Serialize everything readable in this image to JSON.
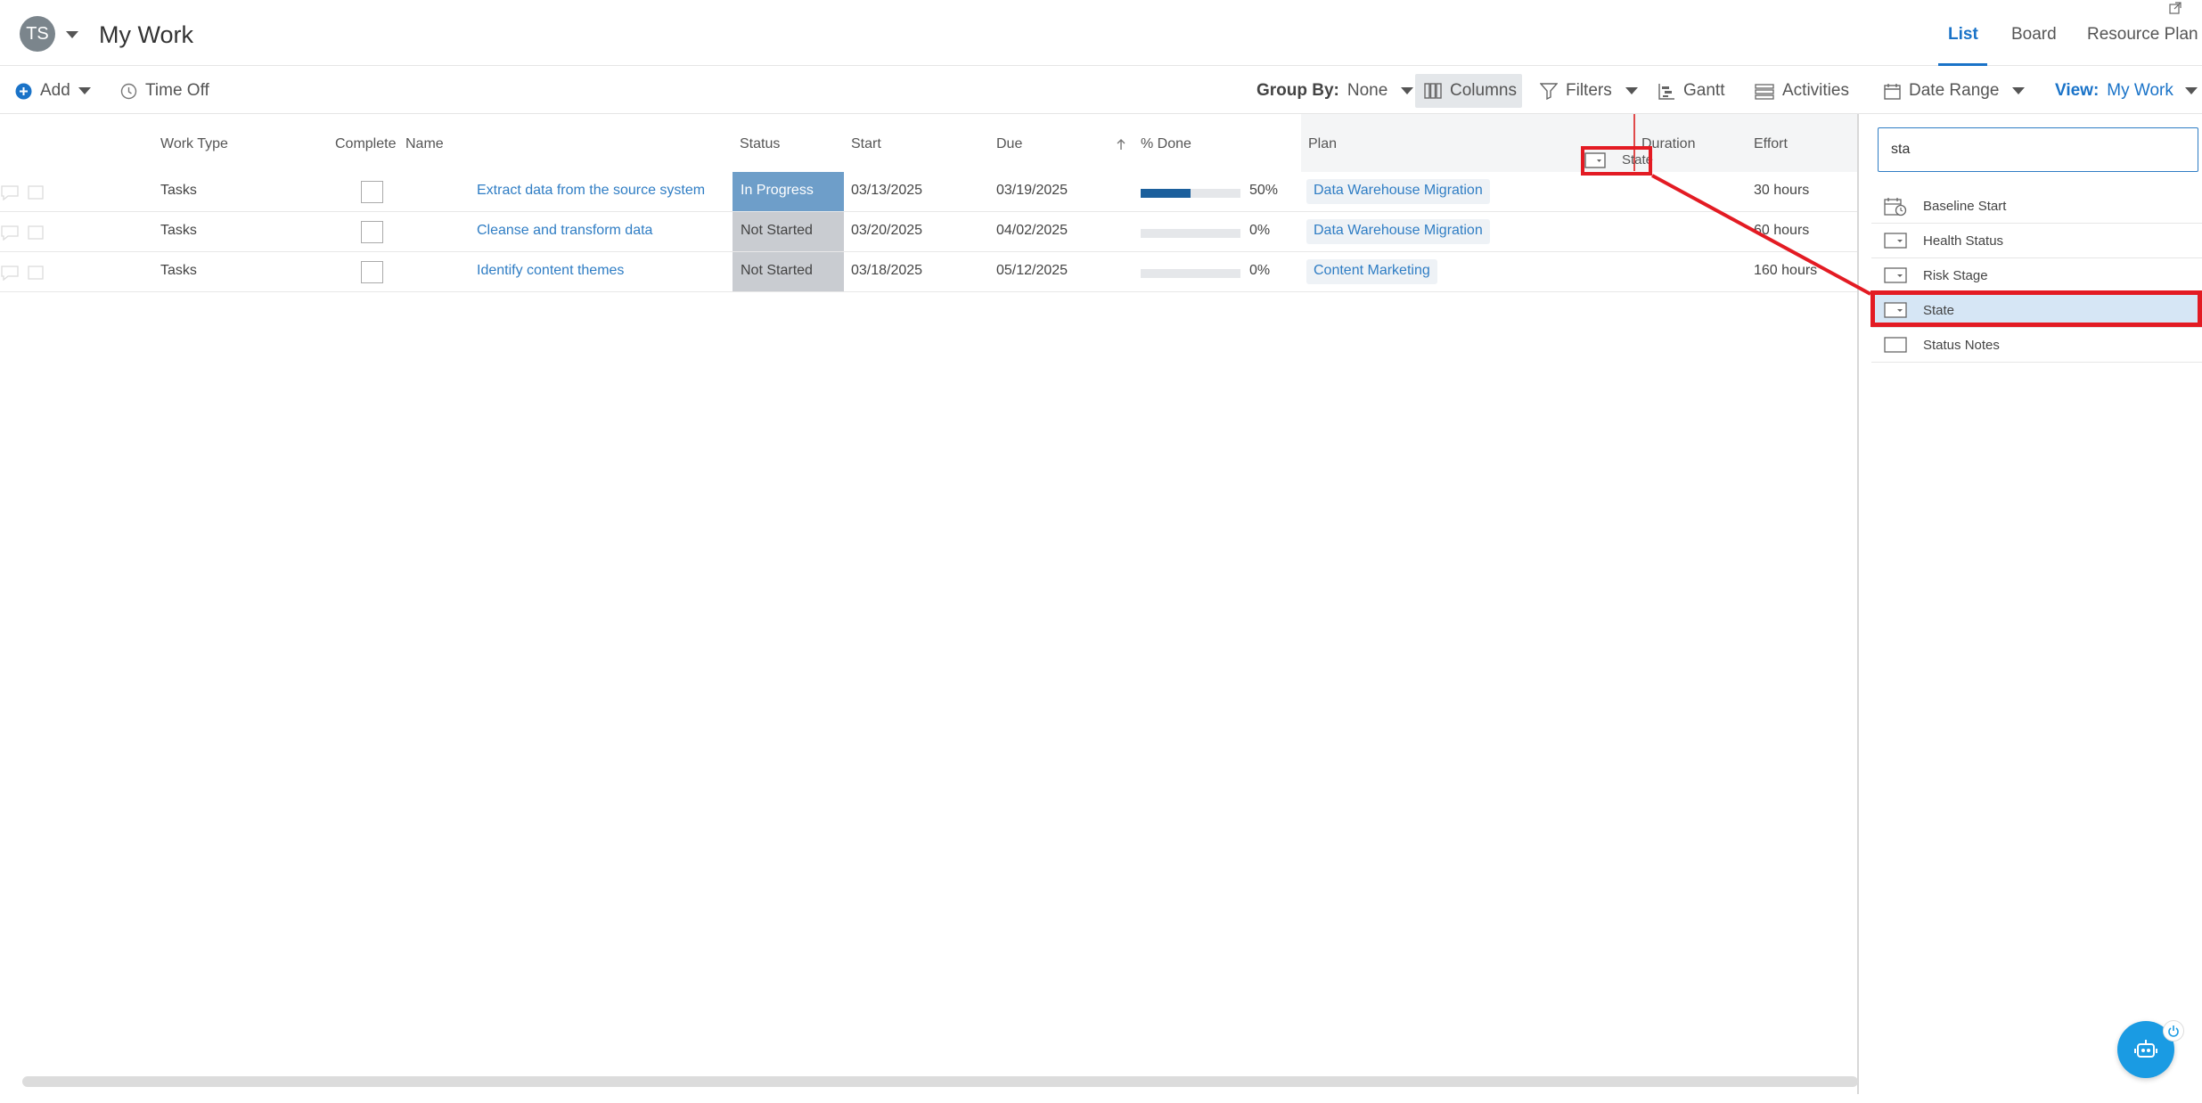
{
  "header": {
    "avatar_initials": "TS",
    "page_title": "My Work",
    "view_tabs": [
      {
        "label": "List",
        "active": true
      },
      {
        "label": "Board",
        "active": false
      },
      {
        "label": "Resource Plan",
        "active": false
      }
    ]
  },
  "toolbar": {
    "add_label": "Add",
    "time_off_label": "Time Off",
    "group_by_label": "Group By:",
    "group_by_value": "None",
    "columns_label": "Columns",
    "filters_label": "Filters",
    "gantt_label": "Gantt",
    "activities_label": "Activities",
    "date_range_label": "Date Range",
    "view_label": "View:",
    "view_value": "My Work"
  },
  "table": {
    "headers": {
      "work_type": "Work Type",
      "complete": "Complete",
      "name": "Name",
      "status": "Status",
      "start": "Start",
      "due": "Due",
      "pct_done": "% Done",
      "plan": "Plan",
      "duration": "Duration",
      "effort": "Effort"
    },
    "dragged_column_label": "State",
    "rows": [
      {
        "work_type": "Tasks",
        "name": "Extract data from the source system",
        "status": "In Progress",
        "start": "03/13/2025",
        "due": "03/19/2025",
        "pct_done": 50,
        "pct_label": "50%",
        "plan": "Data Warehouse Migration",
        "effort": "30 hours"
      },
      {
        "work_type": "Tasks",
        "name": "Cleanse and transform data",
        "status": "Not Started",
        "start": "03/20/2025",
        "due": "04/02/2025",
        "pct_done": 0,
        "pct_label": "0%",
        "plan": "Data Warehouse Migration",
        "effort": "60 hours"
      },
      {
        "work_type": "Tasks",
        "name": "Identify content themes",
        "status": "Not Started",
        "start": "03/18/2025",
        "due": "05/12/2025",
        "pct_done": 0,
        "pct_label": "0%",
        "plan": "Content Marketing",
        "effort": "160 hours"
      }
    ]
  },
  "column_picker": {
    "search_value": "sta",
    "options": [
      {
        "label": "Baseline Start",
        "icon": "calendar-clock-icon"
      },
      {
        "label": "Health Status",
        "icon": "dropdown-field-icon"
      },
      {
        "label": "Risk Stage",
        "icon": "dropdown-field-icon"
      },
      {
        "label": "State",
        "icon": "dropdown-field-icon",
        "selected": true
      },
      {
        "label": "Status Notes",
        "icon": "text-field-icon"
      }
    ]
  },
  "colors": {
    "accent": "#1a73c8",
    "in_progress_bg": "#6e9ec9",
    "not_started_bg": "#c9ccd1",
    "highlight_red": "#e31b23",
    "selected_option_bg": "#d6e6f5"
  }
}
